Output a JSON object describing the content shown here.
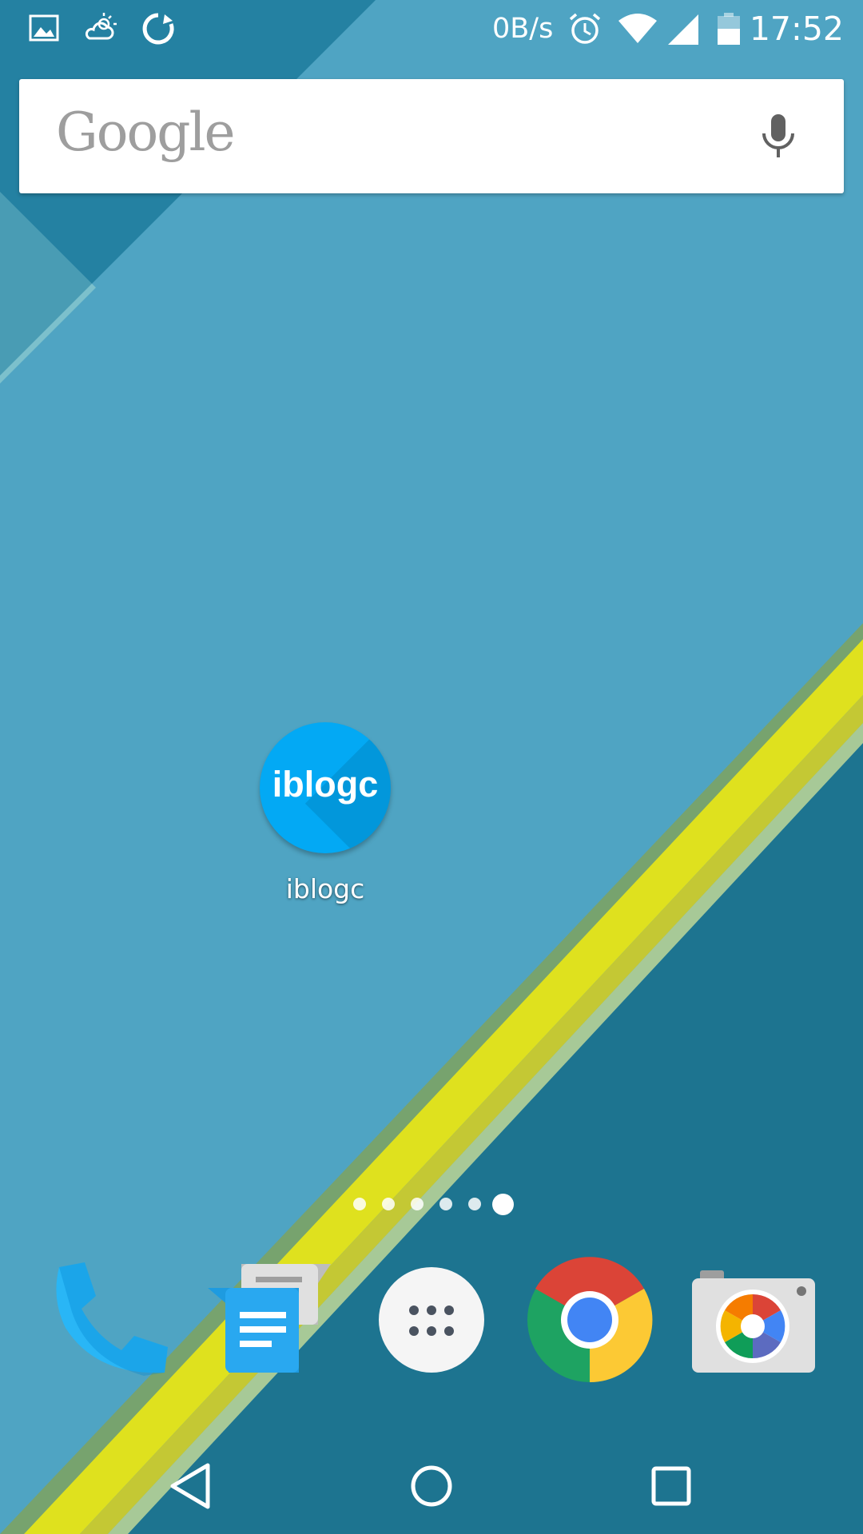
{
  "status_bar": {
    "icons_left": [
      "image-icon",
      "weather-icon",
      "sync-icon"
    ],
    "net_speed": "0B/s",
    "icons_right": [
      "alarm-icon",
      "wifi-icon",
      "signal-icon",
      "battery-icon"
    ],
    "time": "17:52"
  },
  "search": {
    "logo": "Google",
    "mic_icon": "mic-icon"
  },
  "home_apps": [
    {
      "icon_text": "iblogc",
      "label": "iblogc",
      "color": "#03a9f4"
    }
  ],
  "page_indicator": {
    "pages": 6,
    "current": 6
  },
  "dock": [
    {
      "name": "phone",
      "icon": "phone-icon"
    },
    {
      "name": "messenger",
      "icon": "messenger-icon"
    },
    {
      "name": "app-drawer",
      "icon": "apps-grid-icon"
    },
    {
      "name": "chrome",
      "icon": "chrome-icon"
    },
    {
      "name": "camera",
      "icon": "camera-icon"
    }
  ],
  "nav": {
    "buttons": [
      "back-icon",
      "home-icon",
      "recents-icon"
    ]
  },
  "colors": {
    "wallpaper_main": "#4ea3c2",
    "wallpaper_dark": "#1c7591",
    "accent_yellow": "#d9dc1b",
    "app_blue": "#03a9f4"
  }
}
